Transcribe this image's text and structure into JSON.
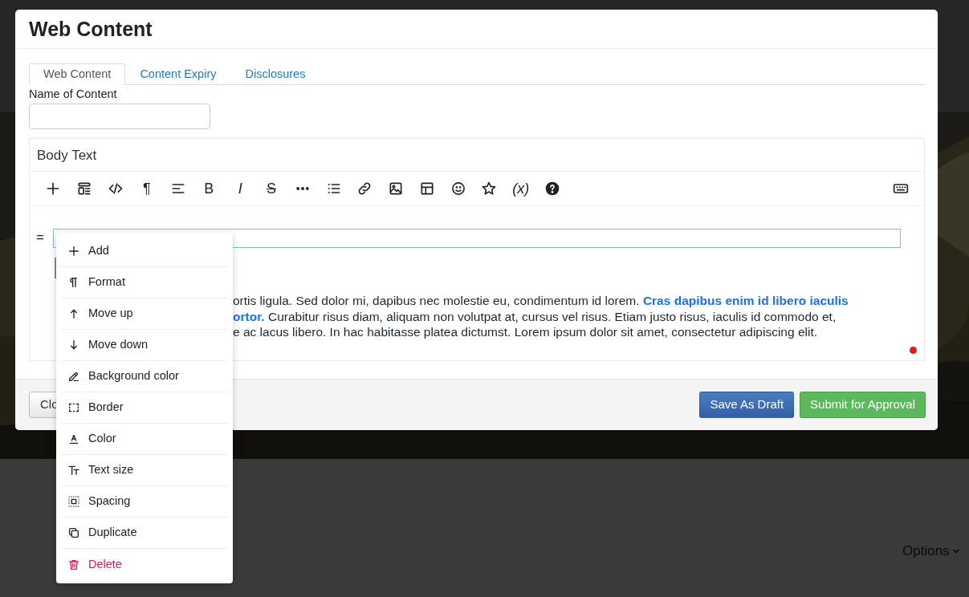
{
  "modal": {
    "title": "Web Content",
    "tabs": [
      {
        "label": "Web Content",
        "selected": true
      },
      {
        "label": "Content Expiry",
        "selected": false
      },
      {
        "label": "Disclosures",
        "selected": false
      }
    ],
    "name_field": {
      "label": "Name of Content"
    },
    "editor": {
      "title": "Body Text",
      "toolbar": [
        {
          "kind": "icon"
        },
        {
          "kind": "icon"
        },
        {
          "kind": "icon"
        },
        {
          "kind": "glyph",
          "text": "¶"
        },
        {
          "kind": "icon"
        },
        {
          "kind": "glyph",
          "text": "B"
        },
        {
          "kind": "italic",
          "text": "I"
        },
        {
          "kind": "strike",
          "text": "S"
        },
        {
          "kind": "icon"
        },
        {
          "kind": "icon"
        },
        {
          "kind": "icon"
        },
        {
          "kind": "icon"
        },
        {
          "kind": "icon"
        },
        {
          "kind": "icon"
        },
        {
          "kind": "icon"
        },
        {
          "kind": "italic",
          "text": "(x)"
        },
        {
          "kind": "icon"
        }
      ],
      "handle": "=",
      "lines": [
        "ortis ligula. Sed dolor mi, dapibus nec molestie eu, condimentum id lorem. **Cras dapibus enim id libero iaculis**",
        "**ortor.** Curabitur risus diam, aliquam non volutpat at, cursus vel risus. Etiam justo risus, iaculis id commodo et,",
        "e ac lacus libero. In hac habitasse platea dictumst. Lorem ipsum dolor sit amet, consectetur adipiscing elit."
      ]
    },
    "footer": {
      "close": "Clo",
      "buttons": [
        {
          "label": "Save As Draft",
          "kind": "primary"
        },
        {
          "label": "Submit for Approval",
          "kind": "success"
        }
      ]
    }
  },
  "context_menu": [
    {
      "label": "Add",
      "kind": "normal"
    },
    {
      "label": "Format",
      "kind": "normal"
    },
    {
      "label": "Move up",
      "kind": "normal"
    },
    {
      "label": "Move down",
      "kind": "normal"
    },
    {
      "label": "Background color",
      "kind": "normal"
    },
    {
      "label": "Border",
      "kind": "normal"
    },
    {
      "label": "Color",
      "kind": "normal"
    },
    {
      "label": "Text size",
      "kind": "normal"
    },
    {
      "label": "Spacing",
      "kind": "normal"
    },
    {
      "label": "Duplicate",
      "kind": "normal"
    },
    {
      "label": "Delete",
      "kind": "danger"
    }
  ],
  "options_button": {
    "label": "Options"
  }
}
